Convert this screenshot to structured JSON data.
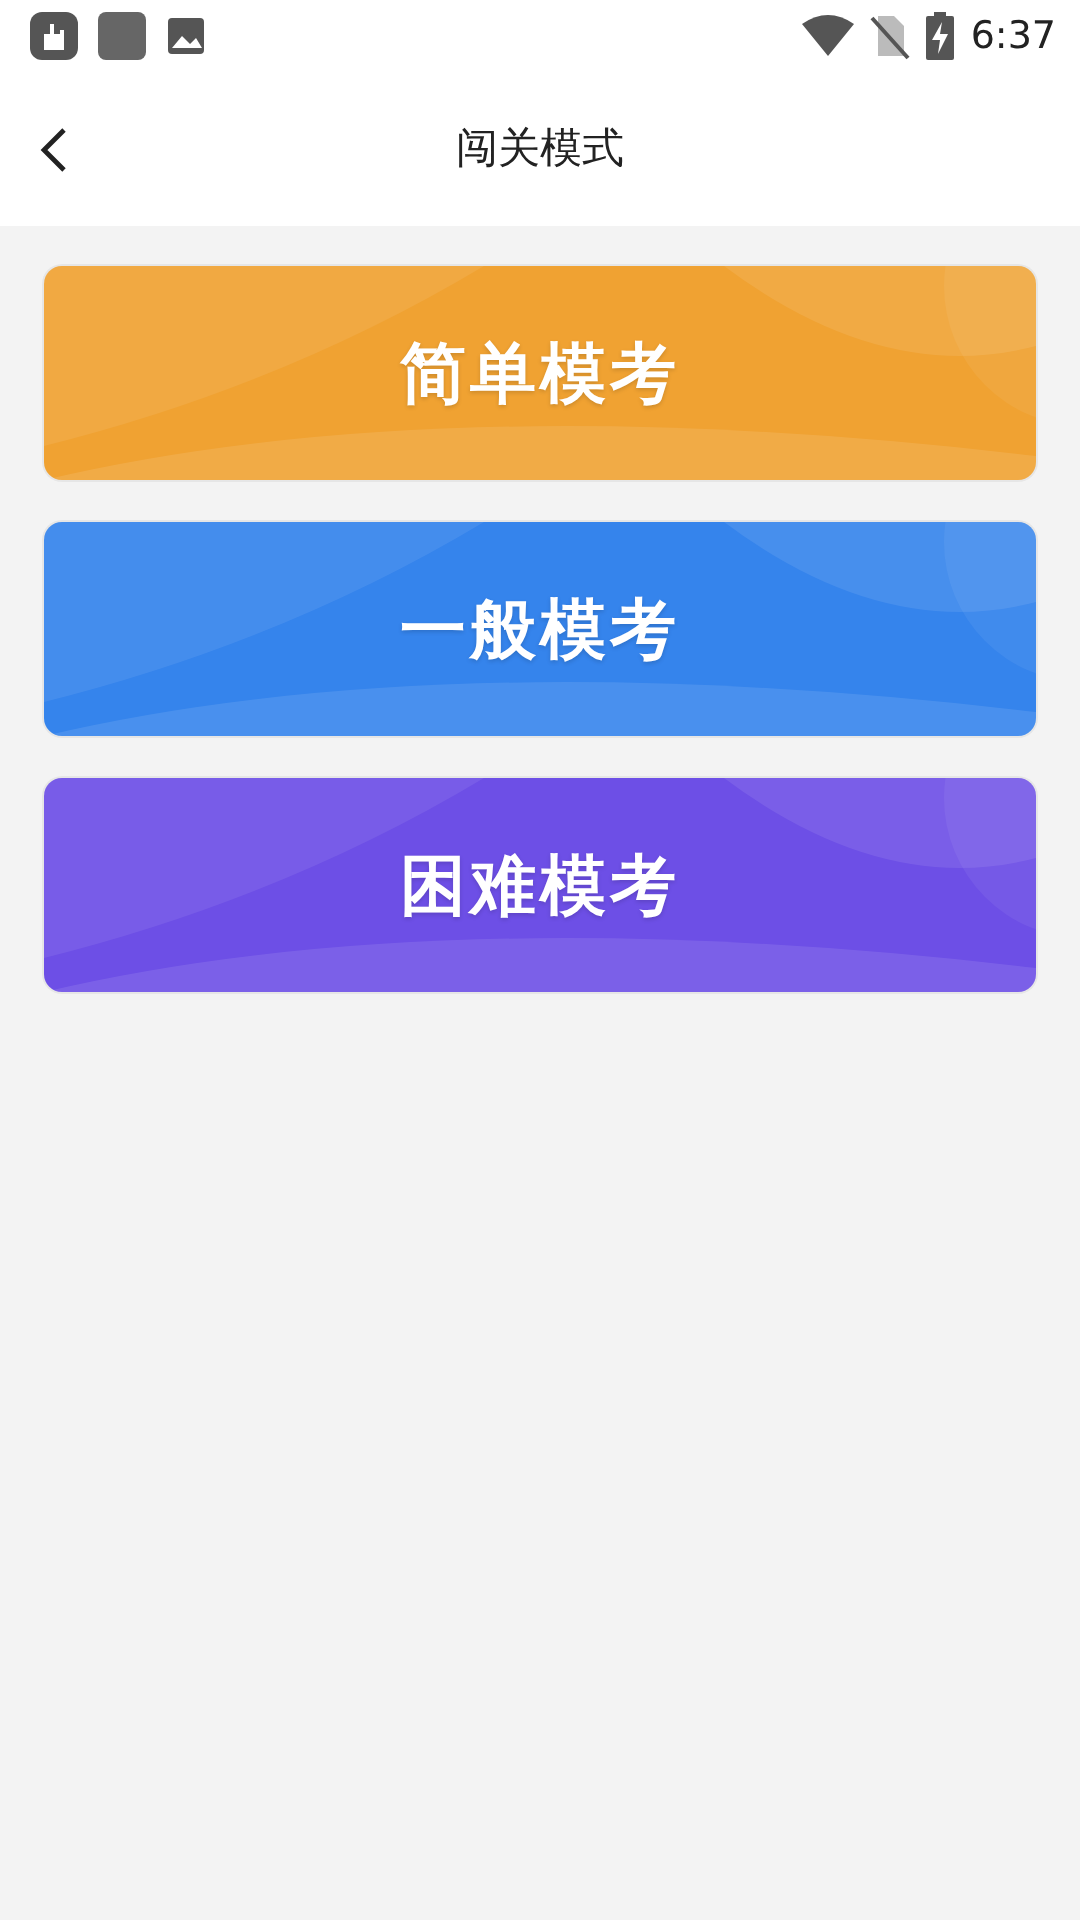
{
  "status_bar": {
    "time": "6:37"
  },
  "header": {
    "title": "闯关模式"
  },
  "levels": [
    {
      "label": "简单模考",
      "color": "#f0a232"
    },
    {
      "label": "一般模考",
      "color": "#3584ec"
    },
    {
      "label": "困难模考",
      "color": "#6d4fe6"
    }
  ]
}
